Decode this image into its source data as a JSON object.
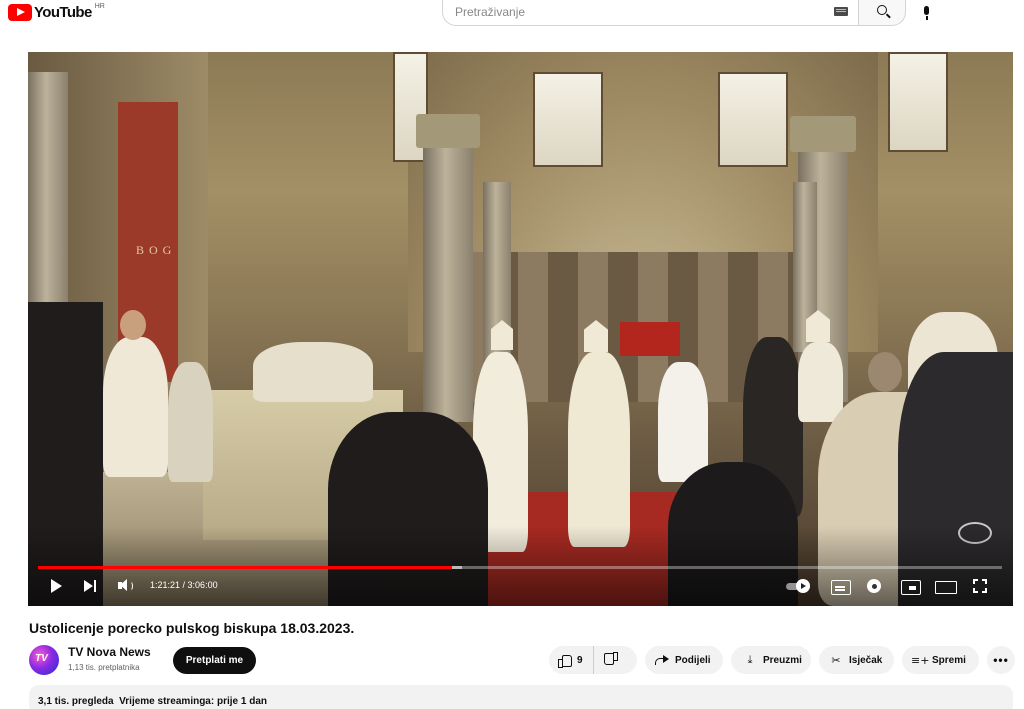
{
  "header": {
    "logo_text": "YouTube",
    "country_code": "HR",
    "search_placeholder": "Pretraživanje"
  },
  "player": {
    "progress_fraction": 0.429,
    "loaded_fraction": 0.44,
    "current_time": "1:21:21",
    "duration": "3:06:00",
    "time_separator": " / ",
    "scene_text": "B O G"
  },
  "video": {
    "title": "Ustolicenje porecko pulskog biskupa 18.03.2023."
  },
  "channel": {
    "name": "TV Nova News",
    "subscribers": "1,13 tis. pretplatnika",
    "subscribe_label": "Pretplati me"
  },
  "actions": {
    "like_count": "9",
    "share_label": "Podijeli",
    "download_label": "Preuzmi",
    "clip_label": "Isječak",
    "save_label": "Spremi"
  },
  "description": {
    "views": "3,1 tis. pregleda",
    "streamed": "Vrijeme streaminga: prije 1 dan"
  },
  "colors": {
    "brand_red": "#ff0000",
    "subscribe_bg": "#0f0f0f",
    "pill_bg": "#f2f2f2"
  },
  "icons": [
    "youtube-logo-icon",
    "keyboard-icon",
    "search-icon",
    "mic-icon",
    "play-icon",
    "next-icon",
    "volume-icon",
    "autoplay-toggle-icon",
    "subtitles-icon",
    "settings-icon",
    "miniplayer-icon",
    "theater-icon",
    "fullscreen-icon",
    "thumb-up-icon",
    "thumb-down-icon",
    "share-icon",
    "download-icon",
    "scissors-icon",
    "playlist-add-icon",
    "more-icon"
  ]
}
